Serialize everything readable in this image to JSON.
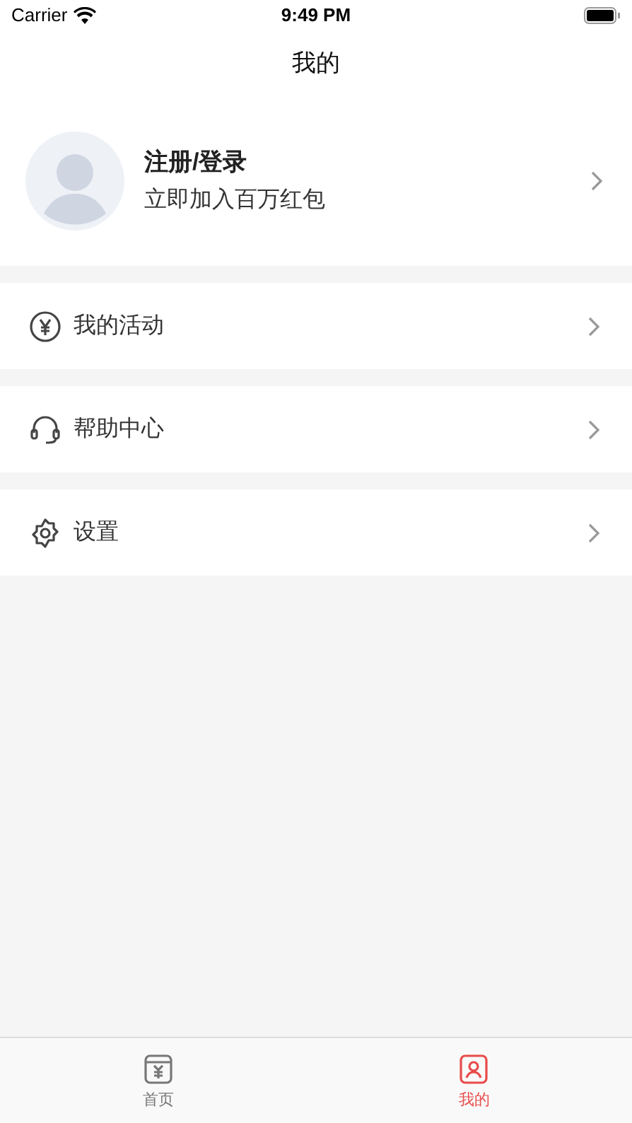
{
  "status_bar": {
    "carrier": "Carrier",
    "time": "9:49 PM"
  },
  "nav": {
    "title": "我的"
  },
  "profile": {
    "title": "注册/登录",
    "subtitle": "立即加入百万红包"
  },
  "menu": [
    {
      "kind": "yen",
      "label": "我的活动"
    },
    {
      "kind": "headset",
      "label": "帮助中心"
    },
    {
      "kind": "gear",
      "label": "设置"
    }
  ],
  "tabs": [
    {
      "kind": "home",
      "label": "首页",
      "selected": false
    },
    {
      "kind": "profile",
      "label": "我的",
      "selected": true
    }
  ]
}
